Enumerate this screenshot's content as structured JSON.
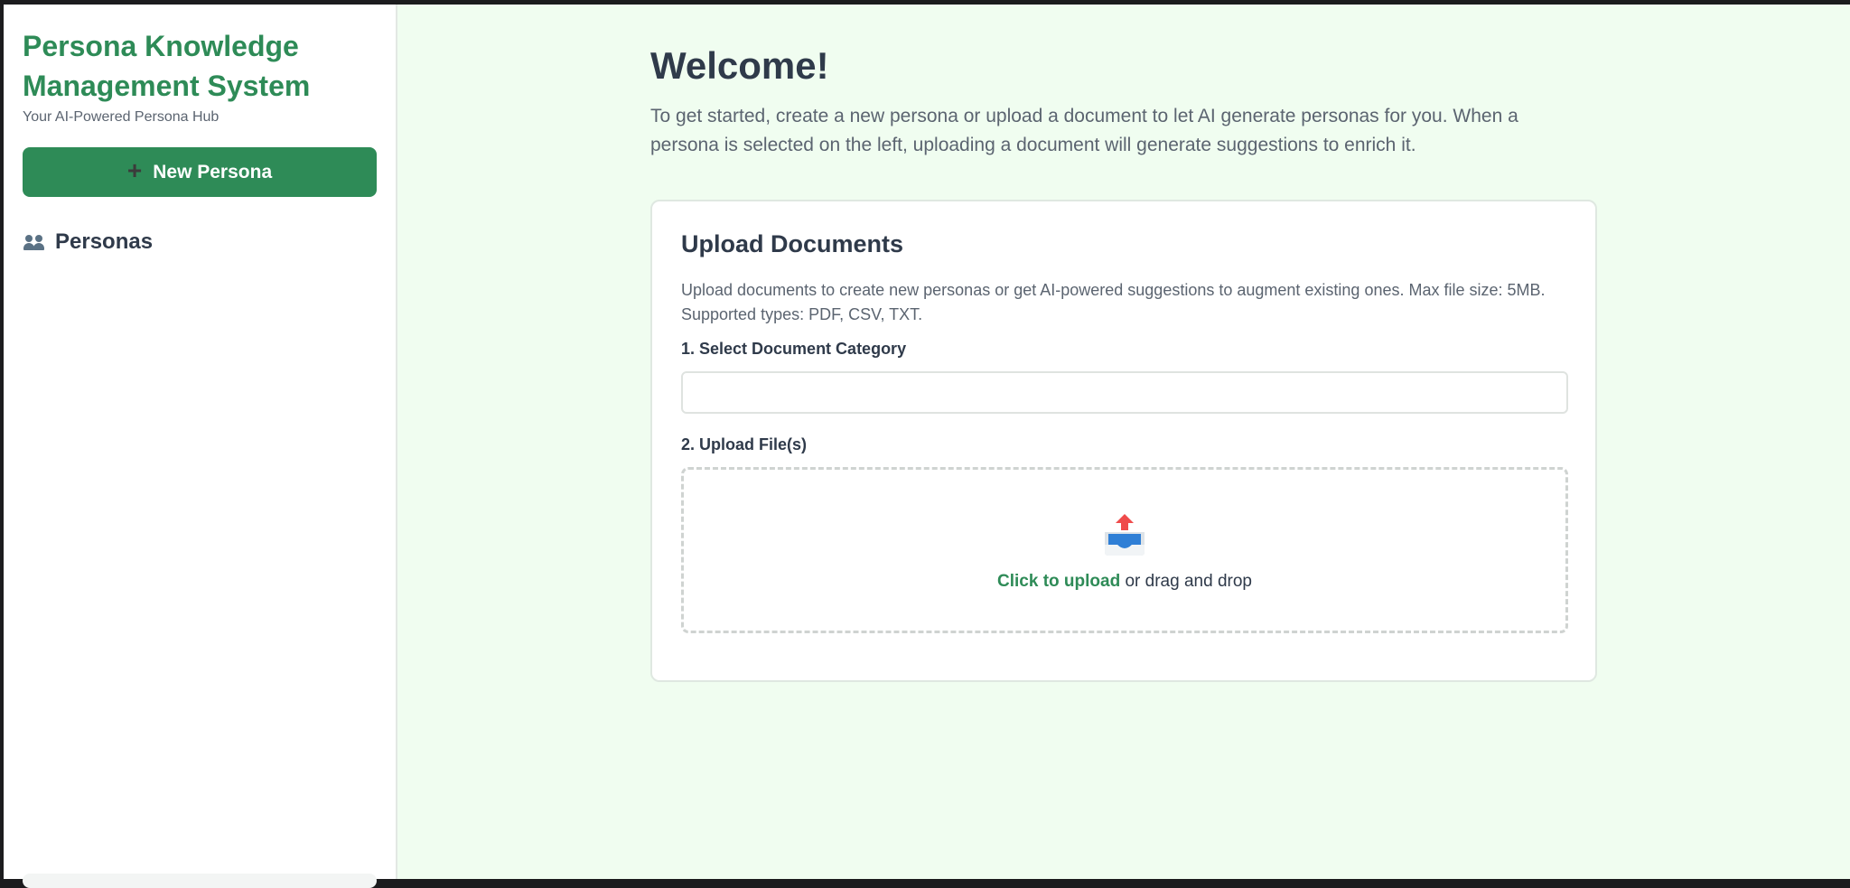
{
  "sidebar": {
    "title": "Persona Knowledge Management System",
    "subtitle": "Your AI-Powered Persona Hub",
    "new_persona_label": "New Persona",
    "personas_heading": "Personas"
  },
  "main": {
    "welcome_title": "Welcome!",
    "welcome_text": "To get started, create a new persona or upload a document to let AI generate personas for you. When a persona is selected on the left, uploading a document will generate suggestions to enrich it.",
    "upload": {
      "title": "Upload Documents",
      "description": "Upload documents to create new personas or get AI-powered suggestions to augment existing ones. Max file size: 5MB. Supported types: PDF, CSV, TXT.",
      "category_label": "1. Select Document Category",
      "category_value": "",
      "files_label": "2. Upload File(s)",
      "click_to_upload": "Click to upload",
      "drag_drop": " or drag and drop"
    }
  },
  "icons": {
    "new_persona": "plus-icon",
    "personas": "people-icon",
    "dropzone": "inbox-tray-icon"
  },
  "colors": {
    "brand": "#2e8b57",
    "main_background": "#f0fdf0",
    "heading_text": "#2f3a4a",
    "muted_text": "#5b6470"
  }
}
